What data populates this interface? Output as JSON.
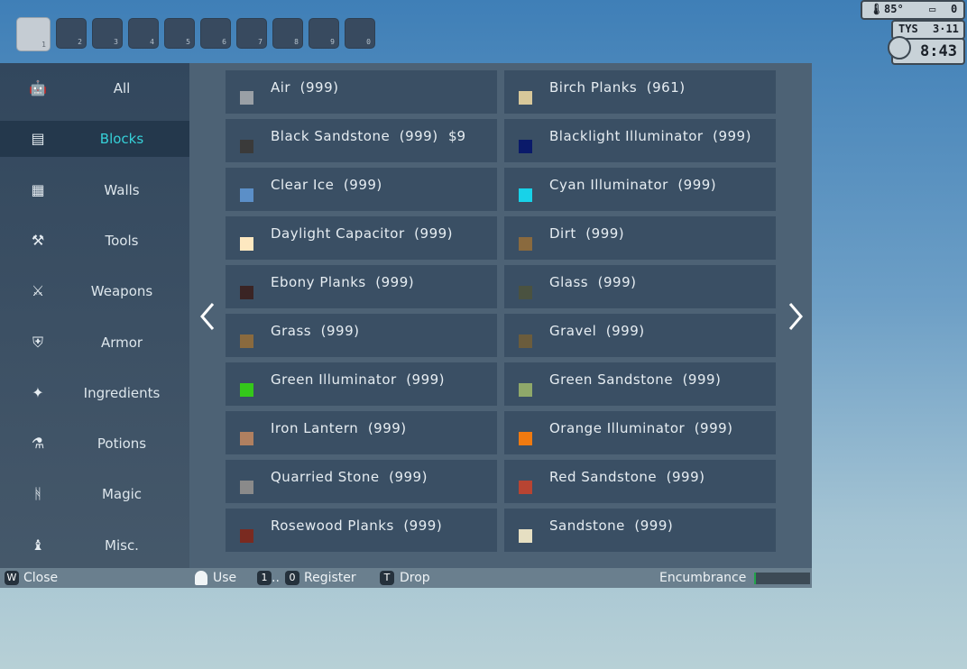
{
  "hotbar": {
    "slots": [
      "1",
      "2",
      "3",
      "4",
      "5",
      "6",
      "7",
      "8",
      "9",
      "0"
    ],
    "active": "1"
  },
  "hud": {
    "temp": "85°",
    "battery": "0",
    "day": "TYS",
    "date": "3·11",
    "time": "8:43"
  },
  "categories": [
    {
      "label": "All",
      "icon": "robot-head-icon",
      "glyph": "🤖"
    },
    {
      "label": "Blocks",
      "icon": "brick-block-icon",
      "glyph": "▤"
    },
    {
      "label": "Walls",
      "icon": "wall-icon",
      "glyph": "▦"
    },
    {
      "label": "Tools",
      "icon": "hammer-icon",
      "glyph": "⚒"
    },
    {
      "label": "Weapons",
      "icon": "crossed-swords-icon",
      "glyph": "⚔"
    },
    {
      "label": "Armor",
      "icon": "armor-icon",
      "glyph": "⛨"
    },
    {
      "label": "Ingredients",
      "icon": "ingredients-icon",
      "glyph": "✦"
    },
    {
      "label": "Potions",
      "icon": "potion-jar-icon",
      "glyph": "⚗"
    },
    {
      "label": "Magic",
      "icon": "magic-rune-icon",
      "glyph": "ᚻ"
    },
    {
      "label": "Misc.",
      "icon": "bag-icon",
      "glyph": "♝"
    }
  ],
  "selected_category": "Blocks",
  "items": [
    {
      "name": "Air  (999)",
      "color": "#9aa0a6"
    },
    {
      "name": "Birch Planks  (961)",
      "color": "#d8c89a"
    },
    {
      "name": "Black Sandstone  (999)",
      "color": "#3a3a3a",
      "price": "$9"
    },
    {
      "name": "Blacklight Illuminator  (999)",
      "color": "#0a1a6a"
    },
    {
      "name": "Clear Ice  (999)",
      "color": "#5b8fc8"
    },
    {
      "name": "Cyan Illuminator  (999)",
      "color": "#18d2e8"
    },
    {
      "name": "Daylight Capacitor  (999)",
      "color": "#fde8c0"
    },
    {
      "name": "Dirt  (999)",
      "color": "#8a6a3e"
    },
    {
      "name": "Ebony Planks  (999)",
      "color": "#3a2424"
    },
    {
      "name": "Glass  (999)",
      "color": "#4a5240"
    },
    {
      "name": "Grass  (999)",
      "color": "#8a6a3e"
    },
    {
      "name": "Gravel  (999)",
      "color": "#6b5c3c"
    },
    {
      "name": "Green Illuminator  (999)",
      "color": "#34c81a"
    },
    {
      "name": "Green Sandstone  (999)",
      "color": "#8fa86a"
    },
    {
      "name": "Iron Lantern  (999)",
      "color": "#b08060"
    },
    {
      "name": "Orange Illuminator  (999)",
      "color": "#f07a10"
    },
    {
      "name": "Quarried Stone  (999)",
      "color": "#8a8a8a"
    },
    {
      "name": "Red Sandstone  (999)",
      "color": "#b84432"
    },
    {
      "name": "Rosewood Planks  (999)",
      "color": "#7a2a20"
    },
    {
      "name": "Sandstone  (999)",
      "color": "#e6dfc2"
    }
  ],
  "footer": {
    "close_key": "W",
    "close": "Close",
    "use": "Use",
    "register_key_a": "1",
    "register_dots": "..",
    "register_key_b": "0",
    "register": "Register",
    "drop_key": "T",
    "drop": "Drop",
    "encumbrance": "Encumbrance",
    "encumbrance_fill": 0.0
  }
}
